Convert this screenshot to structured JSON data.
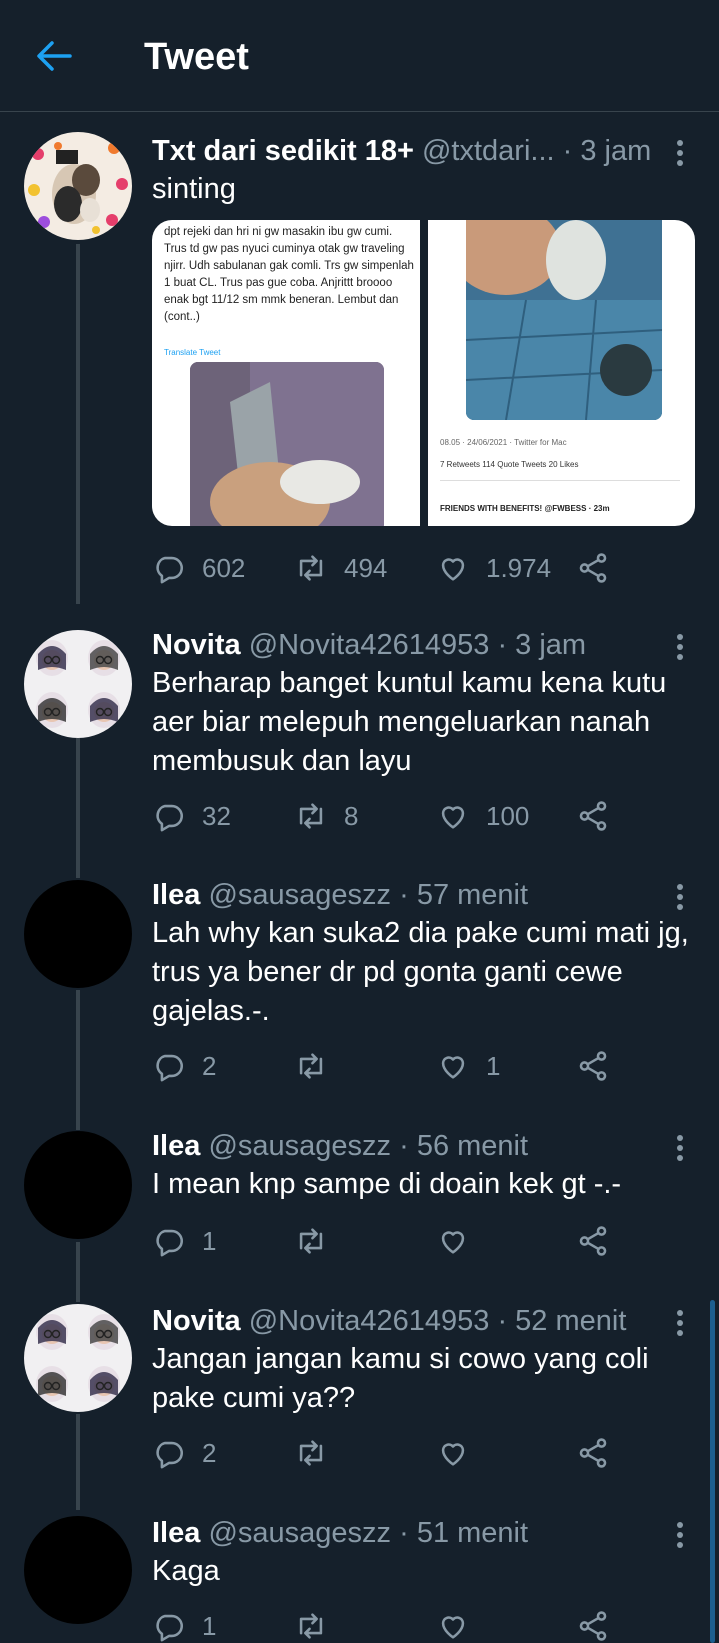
{
  "header": {
    "title": "Tweet"
  },
  "main_tweet": {
    "name": "Txt dari sedikit 18+",
    "handle": "@txtdari...",
    "sep": "·",
    "time": "3 jam",
    "text": "sinting",
    "media": {
      "image1_text": "dpt rejeki dan hri ni gw masakin ibu gw cumi. Trus td gw pas nyuci cuminya otak gw traveling njirr. Udh sabulanan gak comli. Trs gw simpenlah 1 buat CL. Trus pas gue coba. Anjrittt broooo enak bgt 11/12 sm mmk beneran. Lembut dan  (cont..)",
      "image1_translate": "Translate Tweet",
      "image2_meta": "08.05 · 24/06/2021 · Twitter for Mac",
      "image2_stats": "7 Retweets  114 Quote Tweets  20 Likes",
      "image2_quote": "FRIENDS WITH BENEFITS! @FWBESS · 23m"
    },
    "replies": "602",
    "retweets": "494",
    "likes": "1.974"
  },
  "replies": [
    {
      "name": "Novita",
      "handle": "@Novita42614953",
      "sep": "·",
      "time": "3 jam",
      "text": "Berharap banget kuntul kamu kena kutu aer biar melepuh mengeluarkan nanah membusuk dan layu",
      "replies": "32",
      "retweets": "8",
      "likes": "100"
    },
    {
      "name": "Ilea",
      "handle": "@sausageszz",
      "sep": "·",
      "time": "57 menit",
      "text": "Lah why kan suka2 dia pake cumi mati jg, trus ya bener dr pd gonta ganti cewe gajelas.-.",
      "replies": "2",
      "retweets": "",
      "likes": "1"
    },
    {
      "name": "Ilea",
      "handle": "@sausageszz",
      "sep": "·",
      "time": "56 menit",
      "text": "I mean knp sampe di doain kek gt -.-",
      "replies": "1",
      "retweets": "",
      "likes": ""
    },
    {
      "name": "Novita",
      "handle": "@Novita42614953",
      "sep": "·",
      "time": "52 menit",
      "text": "Jangan jangan kamu si cowo yang coli pake cumi ya??",
      "replies": "2",
      "retweets": "",
      "likes": ""
    },
    {
      "name": "Ilea",
      "handle": "@sausageszz",
      "sep": "·",
      "time": "51 menit",
      "text": "Kaga",
      "replies": "1",
      "retweets": "",
      "likes": ""
    }
  ],
  "colors": {
    "background": "#15202b",
    "accent": "#1da1f2",
    "muted": "#8899a6",
    "divider": "#38444d"
  }
}
